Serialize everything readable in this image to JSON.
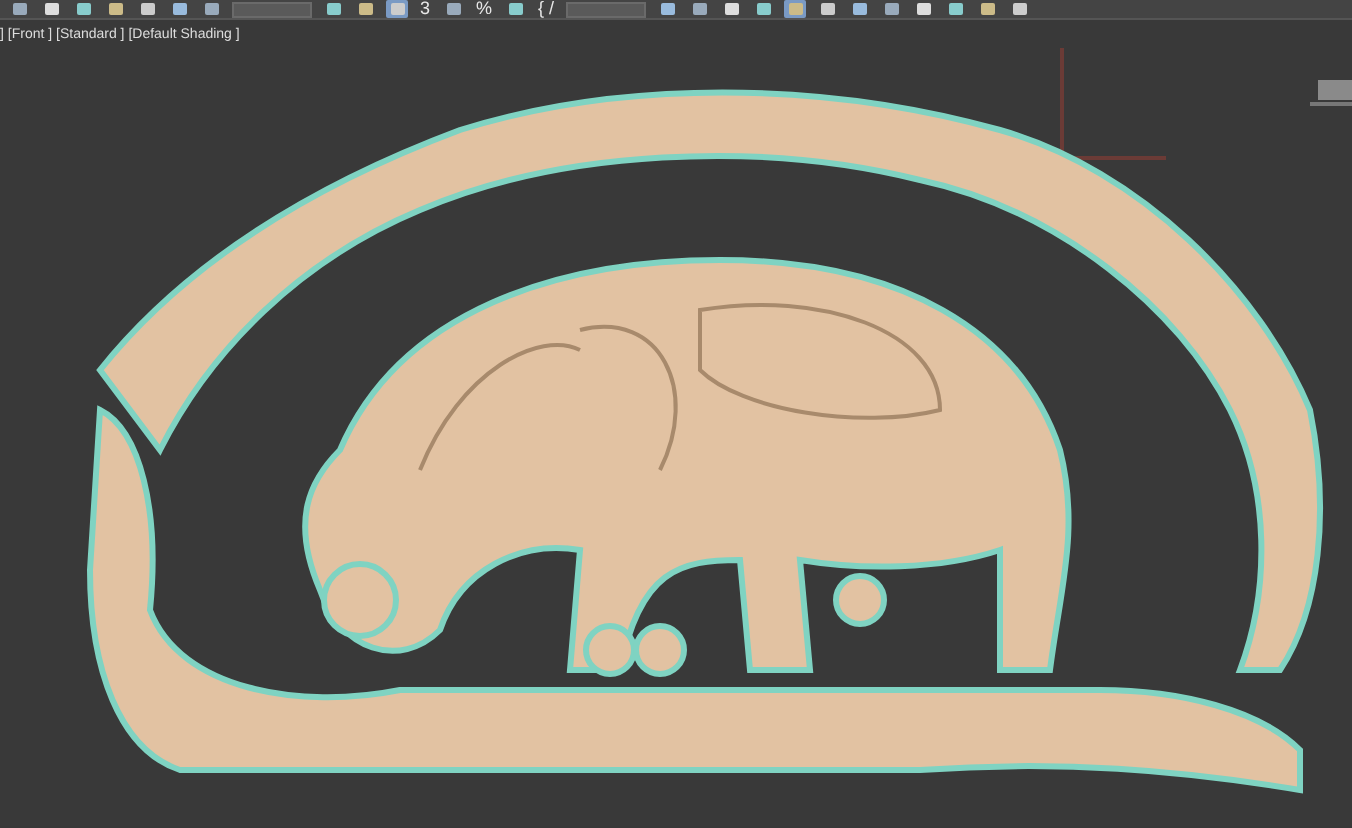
{
  "toolbar": [
    {
      "kind": "icon",
      "selected": false
    },
    {
      "kind": "icon",
      "selected": false
    },
    {
      "kind": "icon",
      "selected": false
    },
    {
      "kind": "icon",
      "selected": false
    },
    {
      "kind": "icon",
      "selected": false
    },
    {
      "kind": "icon",
      "selected": false
    },
    {
      "kind": "icon",
      "selected": false
    },
    {
      "kind": "dropdown",
      "selected": false
    },
    {
      "kind": "icon",
      "selected": false
    },
    {
      "kind": "icon",
      "selected": false
    },
    {
      "kind": "icon",
      "selected": true
    },
    {
      "kind": "text",
      "text": "3",
      "selected": false
    },
    {
      "kind": "icon",
      "selected": false
    },
    {
      "kind": "text",
      "text": "%",
      "selected": false
    },
    {
      "kind": "icon",
      "selected": false
    },
    {
      "kind": "text",
      "text": "{ /",
      "selected": false
    },
    {
      "kind": "dropdown",
      "selected": false
    },
    {
      "kind": "icon",
      "selected": false
    },
    {
      "kind": "icon",
      "selected": false
    },
    {
      "kind": "icon",
      "selected": false
    },
    {
      "kind": "icon",
      "selected": false
    },
    {
      "kind": "icon",
      "selected": true
    },
    {
      "kind": "icon",
      "selected": false
    },
    {
      "kind": "icon",
      "selected": false
    },
    {
      "kind": "icon",
      "selected": false
    },
    {
      "kind": "icon",
      "selected": false
    },
    {
      "kind": "icon",
      "selected": false
    },
    {
      "kind": "icon",
      "selected": false
    },
    {
      "kind": "icon",
      "selected": false
    }
  ],
  "viewport": {
    "label": "] [Front ] [Standard ] [Default Shading ]"
  }
}
